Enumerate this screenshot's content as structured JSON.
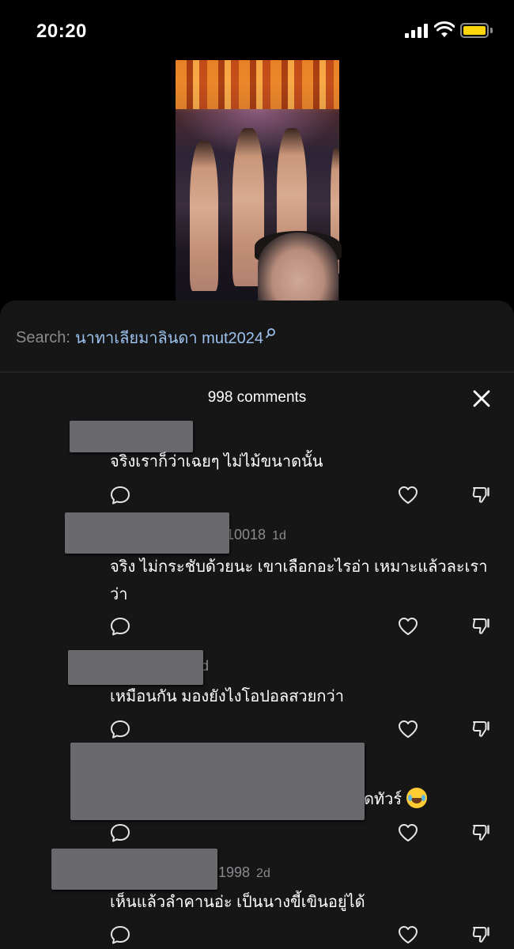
{
  "status_bar": {
    "time": "20:20"
  },
  "search": {
    "label": "Search:",
    "term": "นาทาเลียมาลินดา mut2024"
  },
  "comments_header": {
    "count_text": "998 comments"
  },
  "comments": [
    {
      "username_suffix": "",
      "date": "",
      "text": "จริงเราก็ว่าเฉยๆ ไม่ไม้ขนาดนั้น"
    },
    {
      "username_suffix": "10018",
      "date": "1d",
      "text": "จริง ไม่กระชับด้วยนะ เขาเลือกอะไรอ่า เหมาะแล้วละเราว่า"
    },
    {
      "username_suffix": "d",
      "date": "",
      "text": "เหมือนกัน มองยังไงโอปอลสวยกว่า"
    },
    {
      "username_suffix": "",
      "date": "",
      "text": "ดทัวร์",
      "emoji": "face-with-tears-of-joy"
    },
    {
      "username_suffix": "1998",
      "date": "2d",
      "text": "เห็นแล้วลำคานอ่ะ เป็นนางขี้เขินอยู่ได้"
    }
  ]
}
